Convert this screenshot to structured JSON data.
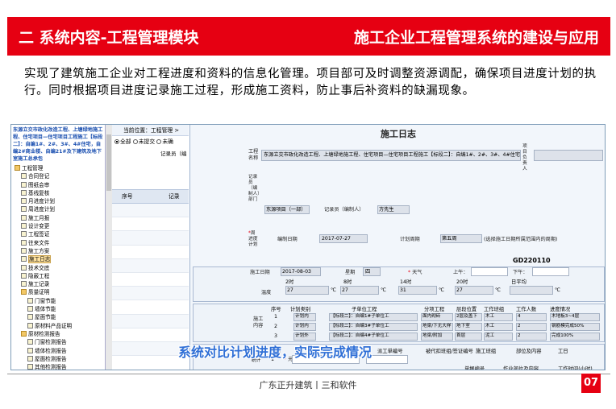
{
  "header": {
    "section_title": "二 系统内容-工程管理模块",
    "system_title": "施工企业工程管理系统的建设与应用"
  },
  "intro": {
    "text": "实现了建筑施工企业对工程进度和资料的信息化管理。项目部可及时调整资源调配，确保项目进度计划的执行。同时根据项目进度记录施工过程，形成施工资料，防止事后补资料的缺漏现象。"
  },
  "tree": {
    "project": "东源立交市政化改造工程、上塘绿地施工程、住宅项目—住宅项目工程施工【标段二】：自编1#、2#、3#、4#住宅，自编2#商业楼、自编21#及下建筑及地下室施工总承包",
    "items": [
      {
        "label": "工程管理",
        "level": 0,
        "folder": true
      },
      {
        "label": "合同登记",
        "level": 1,
        "folder": false
      },
      {
        "label": "图纸会审",
        "level": 1,
        "folder": false
      },
      {
        "label": "基线复核",
        "level": 1,
        "folder": false
      },
      {
        "label": "月进度计划",
        "level": 1,
        "folder": false
      },
      {
        "label": "周进度计划",
        "level": 1,
        "folder": false
      },
      {
        "label": "施工月报",
        "level": 1,
        "folder": false
      },
      {
        "label": "设计变更",
        "level": 1,
        "folder": false
      },
      {
        "label": "工程签证",
        "level": 1,
        "folder": false
      },
      {
        "label": "往来文件",
        "level": 1,
        "folder": false
      },
      {
        "label": "施工方案",
        "level": 1,
        "folder": false
      },
      {
        "label": "施工日志",
        "level": 1,
        "folder": false,
        "selected": true
      },
      {
        "label": "技术交底",
        "level": 1,
        "folder": false
      },
      {
        "label": "隐蔽工程",
        "level": 1,
        "folder": false
      },
      {
        "label": "施工记录",
        "level": 1,
        "folder": false
      },
      {
        "label": "质量证明",
        "level": 1,
        "folder": true
      },
      {
        "label": "门窗节能",
        "level": 2,
        "folder": false
      },
      {
        "label": "墙体节能",
        "level": 2,
        "folder": false
      },
      {
        "label": "屋面节能",
        "level": 2,
        "folder": false
      },
      {
        "label": "原材料产品证明",
        "level": 2,
        "folder": false
      },
      {
        "label": "原材检测报告",
        "level": 1,
        "folder": true
      },
      {
        "label": "门窗检测报告",
        "level": 2,
        "folder": false
      },
      {
        "label": "墙体检测报告",
        "level": 2,
        "folder": false
      },
      {
        "label": "屋面检测报告",
        "level": 2,
        "folder": false
      },
      {
        "label": "其他检测报告",
        "level": 2,
        "folder": false
      },
      {
        "label": "现场检测报告",
        "level": 1,
        "folder": false
      },
      {
        "label": "检查记录",
        "level": 1,
        "folder": false
      }
    ]
  },
  "list": {
    "breadcrumb": "当前位置：工程管理 >",
    "filters": [
      "全部",
      "未提交",
      "未确"
    ],
    "recorder_label": "记录员（编",
    "col_no": "序号",
    "col_rec": "记录"
  },
  "form": {
    "title": "施工日志",
    "project_name_label": "工程名称",
    "project_name_value": "东源立交市政化改造工程、上塘绿地施工程、住宅项目—住宅项目工程施工【标段二】：自编1#、2#、3#、4#住宅",
    "manager_label": "项目负责人",
    "recorder_dept_label": "记录员（编制人）部门",
    "recorder_dept_value": "东源项目（一部）",
    "recorder_label": "记录员（编制人）",
    "recorder_value": "方先生",
    "week_label": "周进度计划",
    "plan_date_label": "编制日期",
    "plan_date_value": "2017-07-27",
    "period_label": "计划周期",
    "period_value": "第五周",
    "period_hint": "(选择施工日期所属范围内的周期)",
    "code": "GD220110",
    "date_label": "施工日期",
    "date_value": "2017-08-03",
    "weekday_label": "星期",
    "weekday_value": "四",
    "weather_label": "天气",
    "am_label": "上午：",
    "pm_label": "下午：",
    "temp_label": "温度",
    "hours": [
      "2时",
      "8时",
      "14时",
      "20时",
      "日平均"
    ],
    "temps": [
      "27",
      "27",
      "31",
      "27",
      ""
    ],
    "unit": "℃",
    "work_label": "施工内容",
    "work_headers": [
      "序号",
      "计划类别",
      "子单位工程",
      "分项工程",
      "层段位置",
      "工作班组",
      "工作人数",
      "进度情况"
    ],
    "work_rows": [
      {
        "no": "1",
        "type": "计划内",
        "unit": "【标段二】：自编1#子单位工",
        "item": "面内砌砖",
        "pos": "2层及盖下",
        "team": "木工",
        "people": "4",
        "status": "木地板3~4层"
      },
      {
        "no": "2",
        "type": "计划内",
        "unit": "【标段二】：自编3#子单位工",
        "item": "地梁/下无大样",
        "pos": "地下室",
        "team": "木工",
        "people": "2",
        "status": "钢筋模完成50%"
      },
      {
        "no": "3",
        "type": "计划外",
        "unit": "【标段二】：自编4#子单位工",
        "item": "地梁/附加",
        "pos": "首层",
        "team": "泥工",
        "people": "2",
        "status": "完成100%"
      }
    ],
    "labor_label": "劳务杂工统计",
    "labor_headers": [
      "序号",
      "派工类型",
      "派工单编号",
      "被代扣班组/签证编号",
      "施工班组",
      "部位及内容",
      "工日"
    ],
    "labor_row_no": "1",
    "labor_row_type": "元",
    "extra_headers": [
      "单据编号",
      "作业部位及内容",
      "工作时间(小时)"
    ]
  },
  "overlay_caption": "系统对比计划进度，实际完成情况",
  "footer": {
    "company": "广东正升建筑丨三和软件",
    "page": "07"
  }
}
